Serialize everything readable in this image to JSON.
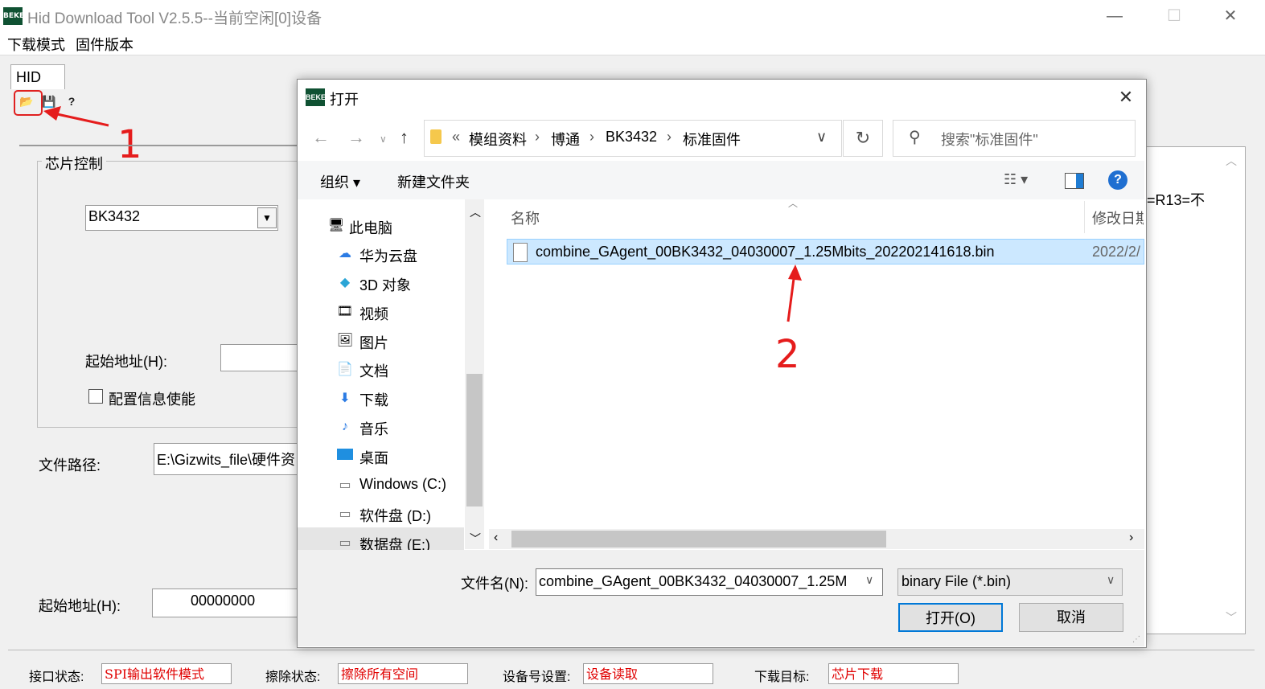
{
  "app": {
    "title": "Hid Download Tool V2.5.5--当前空闲[0]设备",
    "icon_text": "BEKEN",
    "minimize": "—",
    "maximize": "☐",
    "close": "✕"
  },
  "menu": [
    "下载模式",
    "固件版本"
  ],
  "tab": {
    "label": "HID"
  },
  "toolbar": {
    "open_icon": "📂",
    "save_icon": "💾",
    "help_icon": "?"
  },
  "chip_control": {
    "group_label": "芯片控制",
    "chip_select": "BK3432",
    "start_address_label": "起始地址(H):",
    "config_enable_label": "配置信息使能"
  },
  "file_path": {
    "label": "文件路径:",
    "value": "E:\\Gizwits_file\\硬件资"
  },
  "start_address2": {
    "label": "起始地址(H):",
    "value": "00000000"
  },
  "right_panel": {
    "text": "=R13=不"
  },
  "status": {
    "interface_label": "接口状态:",
    "interface_value": "SPI输出软件模式",
    "erase_label": "擦除状态:",
    "erase_value": "擦除所有空间",
    "device_label": "设备号设置:",
    "device_value": "设备读取",
    "target_label": "下载目标:",
    "target_value": "芯片下载"
  },
  "dialog": {
    "title": "打开",
    "breadcrumb": [
      "«",
      "模组资料",
      "博通",
      "BK3432",
      "标准固件"
    ],
    "search_placeholder": "搜索\"标准固件\"",
    "organize": "组织 ▾",
    "new_folder": "新建文件夹",
    "nav_items": [
      {
        "label": "此电脑",
        "icon": "pc-icon"
      },
      {
        "label": "华为云盘",
        "icon": "cloud-icon"
      },
      {
        "label": "3D 对象",
        "icon": "cube-icon"
      },
      {
        "label": "视频",
        "icon": "video-icon"
      },
      {
        "label": "图片",
        "icon": "picture-icon"
      },
      {
        "label": "文档",
        "icon": "document-icon"
      },
      {
        "label": "下载",
        "icon": "download-icon"
      },
      {
        "label": "音乐",
        "icon": "music-icon"
      },
      {
        "label": "桌面",
        "icon": "desktop-icon"
      },
      {
        "label": "Windows (C:)",
        "icon": "drive-icon"
      },
      {
        "label": "软件盘 (D:)",
        "icon": "drive-icon"
      },
      {
        "label": "数据盘 (E:)",
        "icon": "drive-icon"
      }
    ],
    "columns": {
      "name": "名称",
      "date": "修改日期"
    },
    "files": [
      {
        "name": "combine_GAgent_00BK3432_04030007_1.25Mbits_202202141618.bin",
        "date": "2022/2/"
      }
    ],
    "filename_label": "文件名(N):",
    "filename_value": "combine_GAgent_00BK3432_04030007_1.25M",
    "filetype_value": "binary File (*.bin)",
    "open_button": "打开(O)",
    "cancel_button": "取消"
  },
  "annotations": {
    "step1": "1",
    "step2": "2",
    "color": "#e51c1c"
  }
}
